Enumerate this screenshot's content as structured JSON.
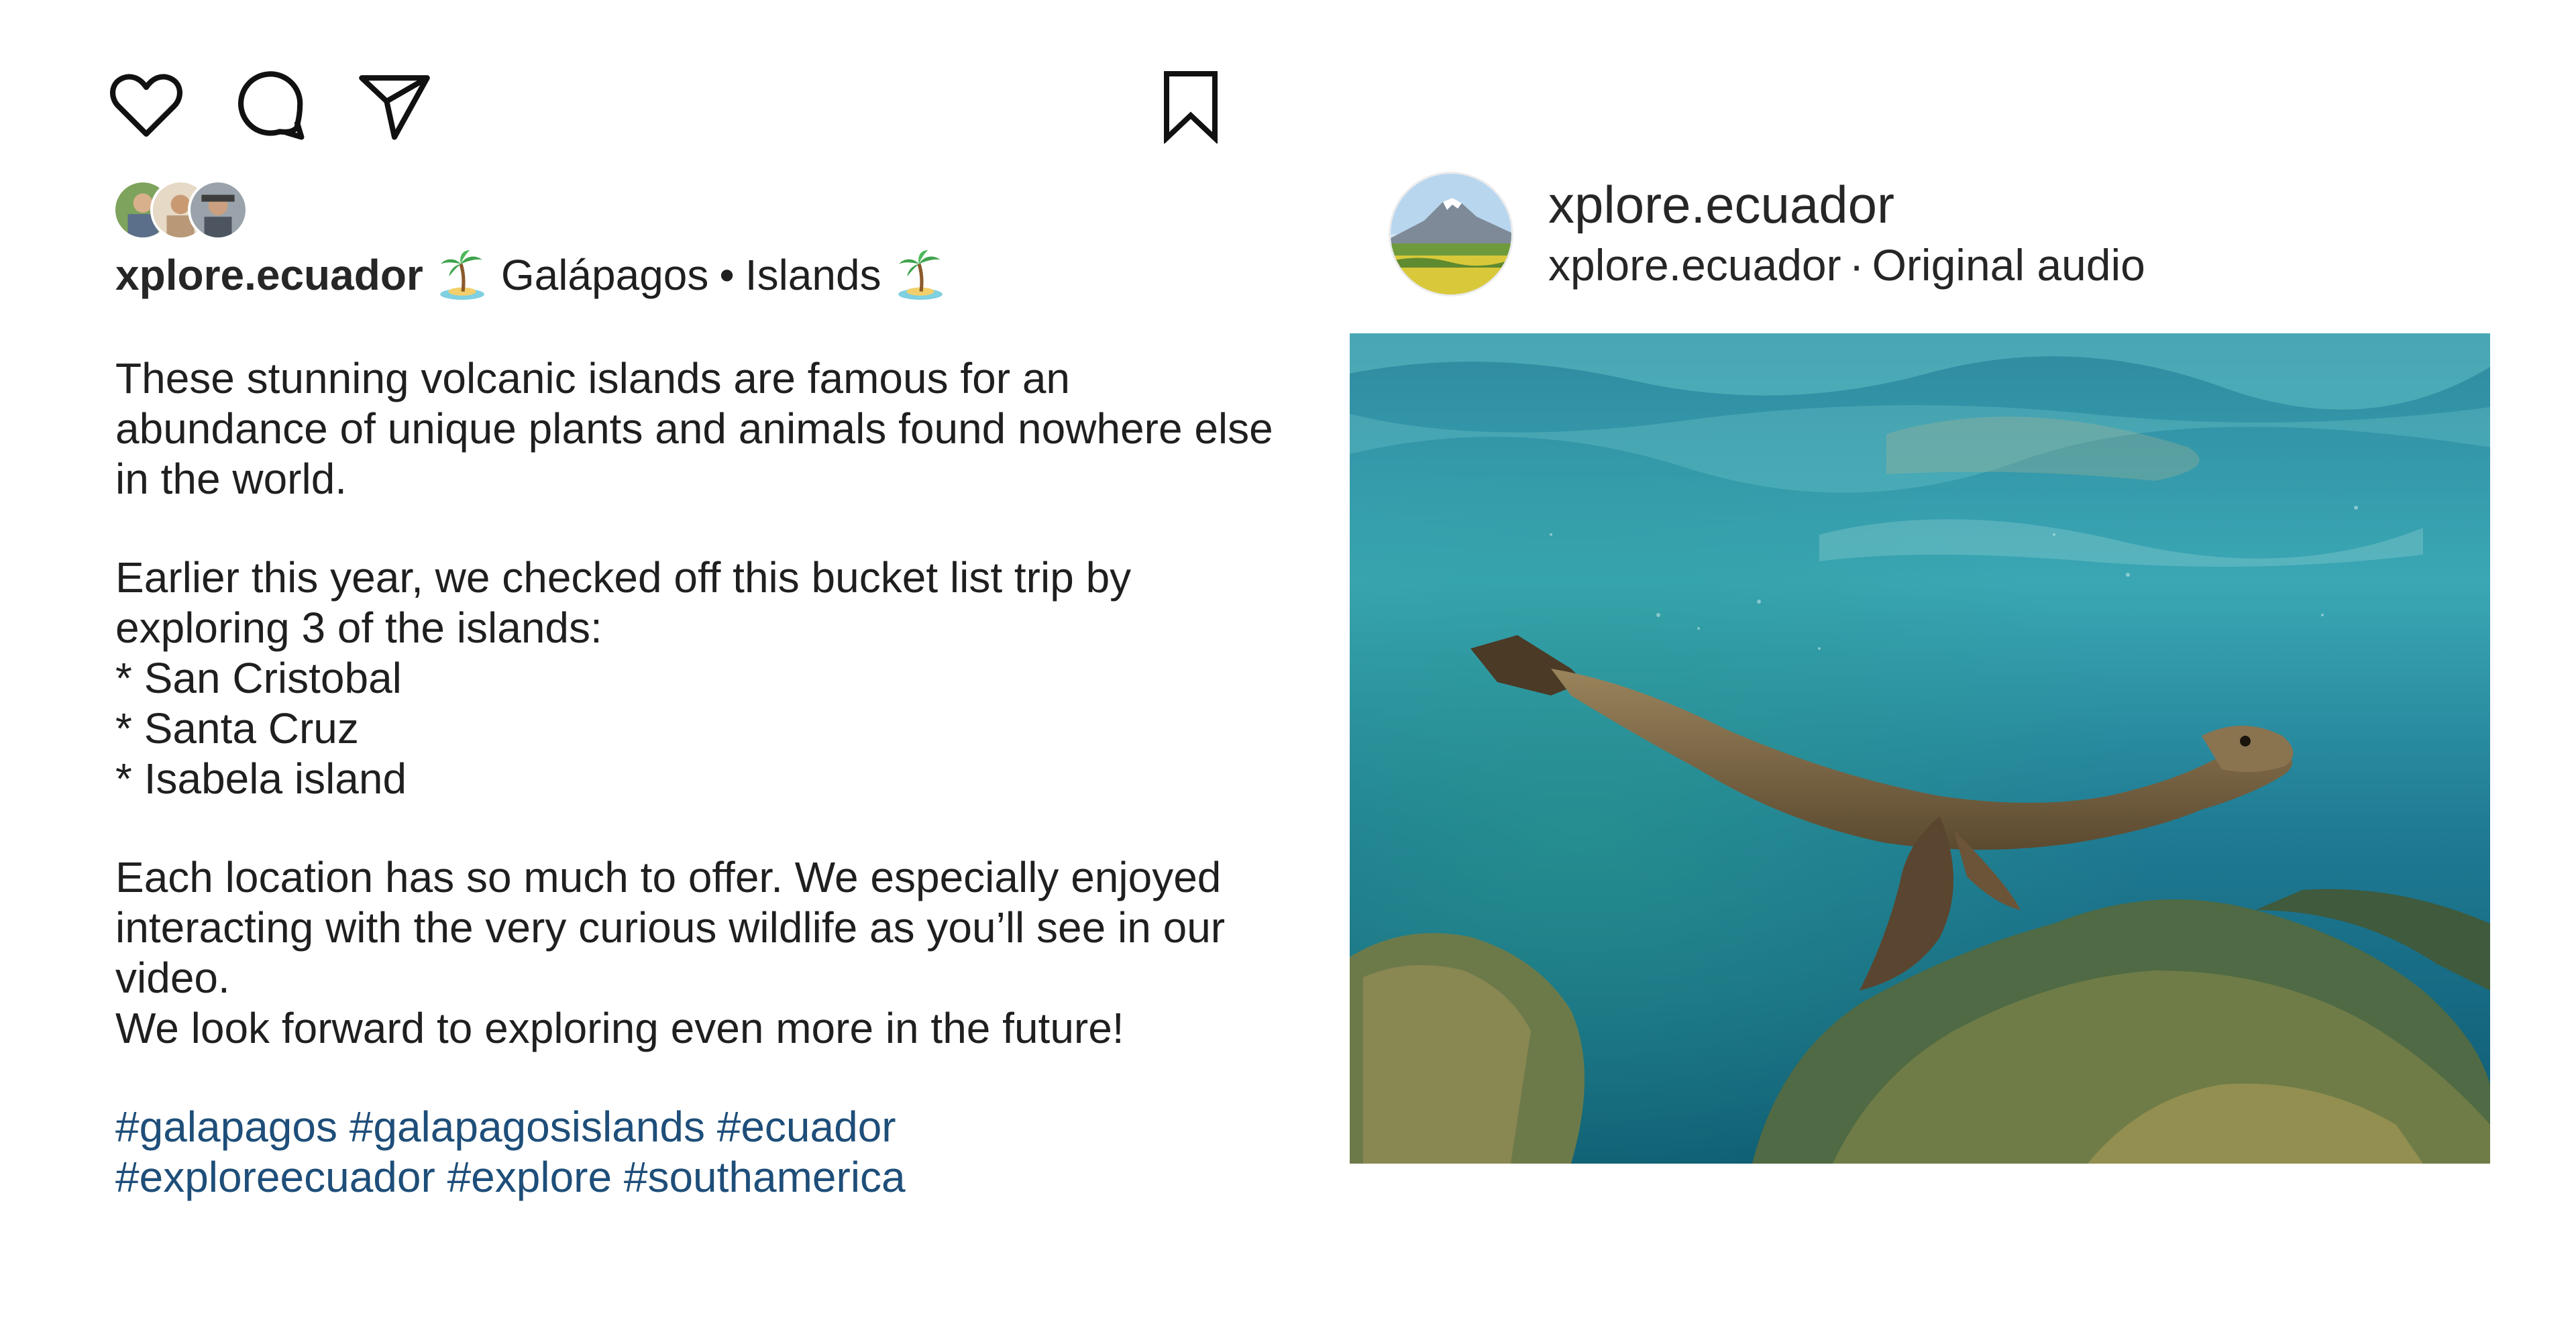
{
  "actions": {
    "like": "heart-icon",
    "comment": "comment-bubble-icon",
    "share": "paper-plane-icon",
    "save": "bookmark-icon"
  },
  "caption": {
    "username": "xplore.ecuador",
    "location_part1": "Galápagos",
    "separator": "•",
    "location_part2": "Islands",
    "paragraph1": "These stunning volcanic islands are famous for an abundance of unique plants and animals found nowhere else in the world.",
    "paragraph2_intro": "Earlier this year, we checked off this bucket list trip by exploring 3 of the islands:",
    "islands": [
      "* San Cristobal",
      "* Santa Cruz",
      "* Isabela island"
    ],
    "paragraph3": "Each location has so much to offer. We especially enjoyed interacting with the very curious wildlife as you’ll see in our video.",
    "paragraph3_end": "We look forward to exploring even more in the future!",
    "hashtags_line1": [
      "#galapagos",
      "#galapagosislands",
      "#ecuador"
    ],
    "hashtags_line2": [
      "#exploreecuador",
      "#explore",
      "#southamerica"
    ]
  },
  "post": {
    "profile_name": "xplore.ecuador",
    "audio_user": "xplore.ecuador",
    "audio_separator": "·",
    "audio_label": "Original audio"
  },
  "colors": {
    "text": "#1f1f1f",
    "hashtag": "#1e4e79",
    "water_deep": "#0f5f78",
    "water_light": "#4fb3be",
    "sea_lion": "#7a6646"
  }
}
